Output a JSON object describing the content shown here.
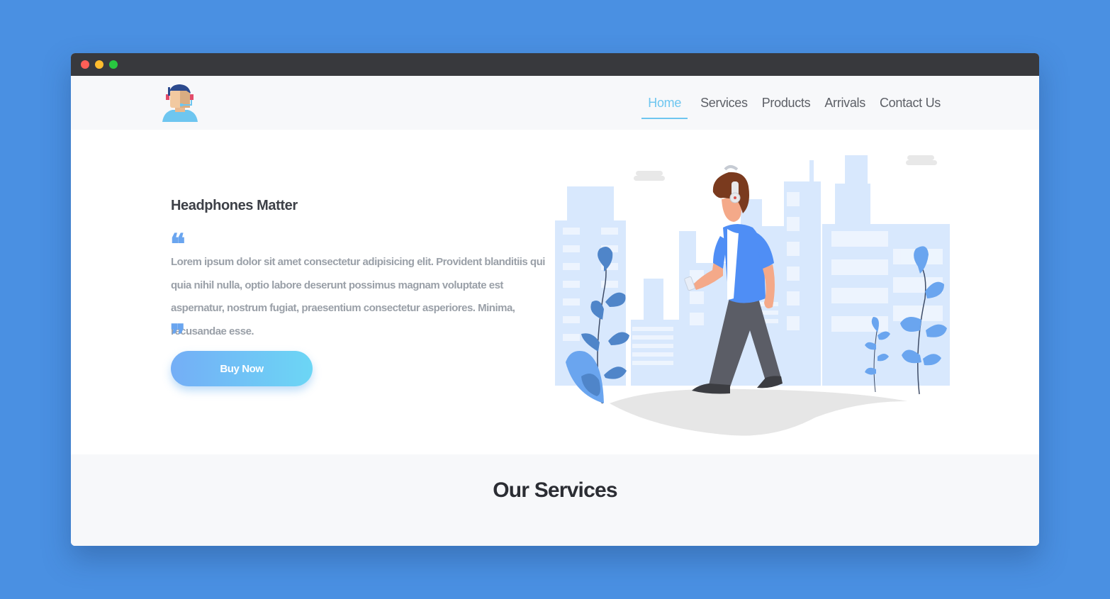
{
  "window": {
    "controls": [
      "close",
      "minimize",
      "maximize"
    ]
  },
  "nav": {
    "logo_icon": "headset-avatar-icon",
    "links": [
      {
        "label": "Home",
        "active": true
      },
      {
        "label": "Services",
        "active": false
      },
      {
        "label": "Products",
        "active": false
      },
      {
        "label": "Arrivals",
        "active": false
      },
      {
        "label": "Contact Us",
        "active": false
      }
    ]
  },
  "hero": {
    "title": "Headphones Matter",
    "text": "Lorem ipsum dolor sit amet consectetur adipisicing elit. Provident blanditiis qui quia nihil nulla, optio labore deserunt possimus magnam voluptate est aspernatur, nostrum fugiat, praesentium consectetur asperiores. Minima, recusandae esse.",
    "quote_open": "❝",
    "quote_close": "❞",
    "button_label": "Buy Now",
    "illustration": "person-walking-with-headphones-illustration"
  },
  "services": {
    "title": "Our Services"
  },
  "colors": {
    "background": "#4a90e2",
    "accent": "#6ec6f0",
    "button_start": "#74aef6",
    "button_end": "#6cd6f5",
    "illustration_blue": "#4f8ef5",
    "city_light": "#d8e8fd"
  }
}
